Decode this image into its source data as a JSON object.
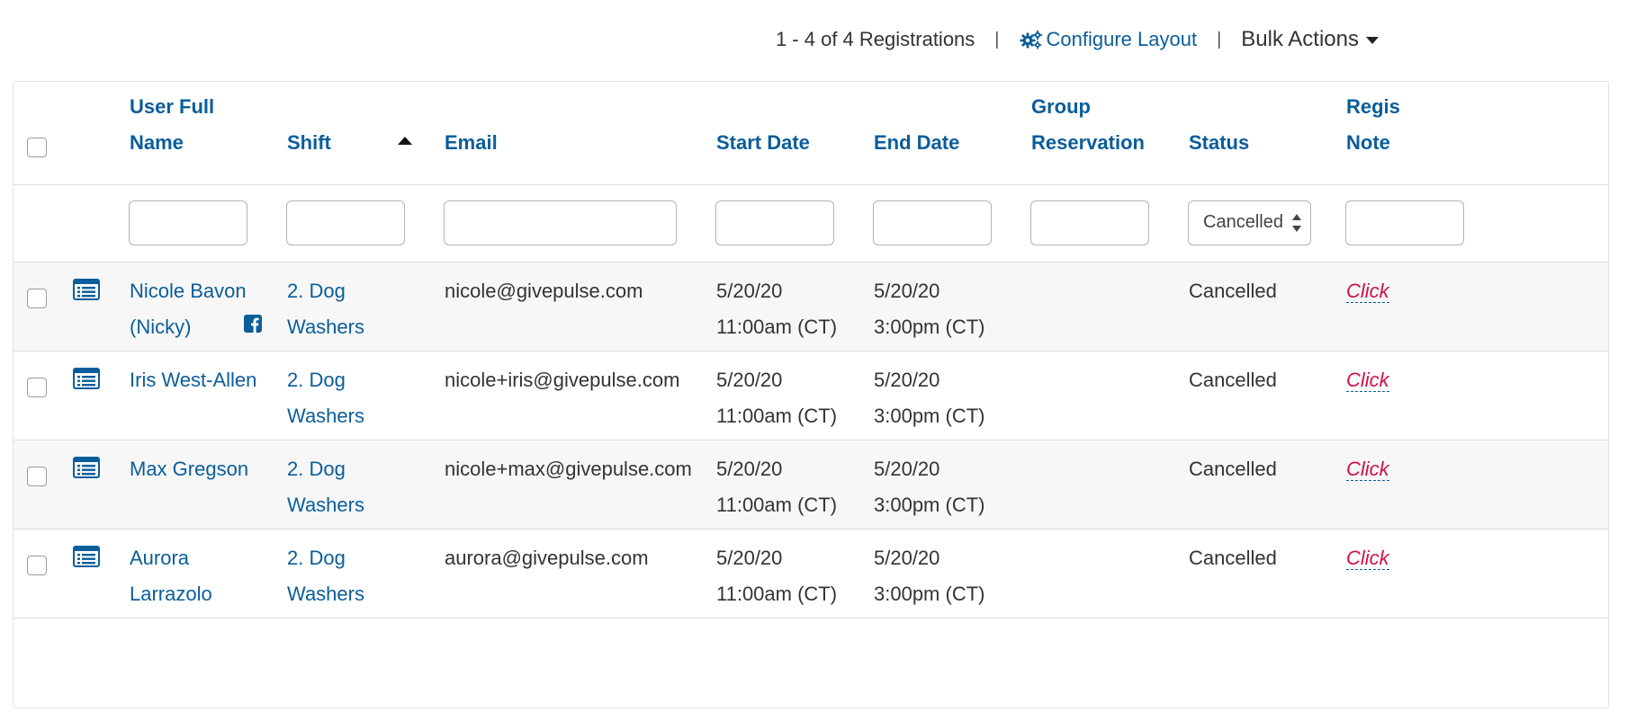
{
  "toolbar": {
    "count_text": "1 - 4 of 4 Registrations",
    "separator": "|",
    "configure_label": "Configure Layout",
    "bulk_label": "Bulk Actions"
  },
  "columns": {
    "user_full_name_line1": "User Full",
    "user_full_name_line2": "Name",
    "shift": "Shift",
    "email": "Email",
    "start_date": "Start Date",
    "end_date": "End Date",
    "group_reservation_line1": "Group",
    "group_reservation_line2": "Reservation",
    "status": "Status",
    "registration_note_line1": "Regis",
    "registration_note_line2": "Note"
  },
  "filters": {
    "status_selected": "Cancelled"
  },
  "rows": [
    {
      "name_line1": "Nicole Bavon",
      "name_line2": "(Nicky)",
      "has_facebook": true,
      "shift_line1": "2. Dog",
      "shift_line2": "Washers",
      "email": "nicole@givepulse.com",
      "start_date": "5/20/20",
      "start_time": "11:00am (CT)",
      "end_date": "5/20/20",
      "end_time": "3:00pm (CT)",
      "group_reservation": "",
      "status": "Cancelled",
      "note_link": "Click"
    },
    {
      "name_line1": "Iris West-Allen",
      "name_line2": "",
      "has_facebook": false,
      "shift_line1": "2. Dog",
      "shift_line2": "Washers",
      "email": "nicole+iris@givepulse.com",
      "start_date": "5/20/20",
      "start_time": "11:00am (CT)",
      "end_date": "5/20/20",
      "end_time": "3:00pm (CT)",
      "group_reservation": "",
      "status": "Cancelled",
      "note_link": "Click"
    },
    {
      "name_line1": "Max Gregson",
      "name_line2": "",
      "has_facebook": false,
      "shift_line1": "2. Dog",
      "shift_line2": "Washers",
      "email": "nicole+max@givepulse.com",
      "start_date": "5/20/20",
      "start_time": "11:00am (CT)",
      "end_date": "5/20/20",
      "end_time": "3:00pm (CT)",
      "group_reservation": "",
      "status": "Cancelled",
      "note_link": "Click"
    },
    {
      "name_line1": "Aurora",
      "name_line2": "Larrazolo",
      "has_facebook": false,
      "shift_line1": "2. Dog",
      "shift_line2": "Washers",
      "email": "aurora@givepulse.com",
      "start_date": "5/20/20",
      "start_time": "11:00am (CT)",
      "end_date": "5/20/20",
      "end_time": "3:00pm (CT)",
      "group_reservation": "",
      "status": "Cancelled",
      "note_link": "Click"
    }
  ],
  "colors": {
    "link_blue": "#0a5d9b",
    "note_link_red": "#d0104c",
    "stripe": "#f7f7f7",
    "text": "#333333"
  },
  "icons": {
    "configure": "gears-icon",
    "bulk_caret": "caret-down-icon",
    "row_detail": "list-details-icon",
    "facebook": "facebook-icon",
    "sort": "sort-asc-icon"
  }
}
